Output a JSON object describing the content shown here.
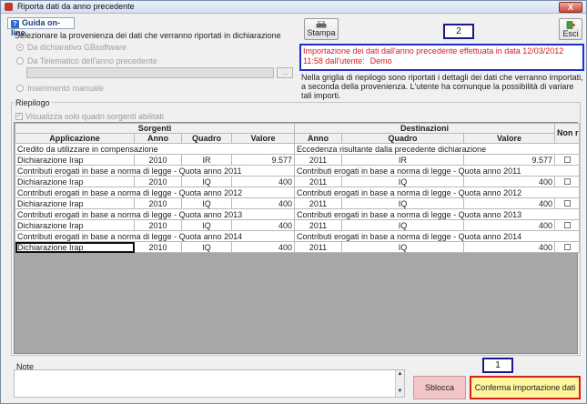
{
  "window": {
    "title": "Riporta dati da anno precedente",
    "close_label": "X"
  },
  "toolbar": {
    "help_label": "Guida on-line",
    "print_label": "Stampa",
    "exit_label": "Esci"
  },
  "provenance": {
    "title": "Selezionare la provenienza dei dati che verranno riportati in dichiarazione",
    "options": [
      "Da dichiarativo GBsoftware",
      "Da Telematico dell'anno precedente",
      "Inserimento manuale"
    ],
    "browse_label": "..."
  },
  "import_info": {
    "line1": "Importazione dei dati dall'anno precedente effettuata in data 12/03/2012",
    "line2": "11:58 dall'utente:",
    "user": "Demo",
    "description": "Nella griglia di riepilogo sono riportati i dettagli dei dati che verranno importati, a seconda della provenienza. L'utente ha comunque la possibilità di variare tali importi."
  },
  "badges": {
    "one": "1",
    "two": "2"
  },
  "summary": {
    "label": "Riepilogo",
    "filter_label": "Visualizza solo quadri sorgenti abilitati",
    "group_sources": "Sorgenti",
    "group_dest": "Destinazioni",
    "columns": {
      "app": "Applicazione",
      "year": "Anno",
      "quadro": "Quadro",
      "value": "Valore",
      "d_year": "Anno",
      "d_quadro": "Quadro",
      "d_value": "Valore",
      "non_rip": "Non rip"
    },
    "rows": [
      {
        "src_cat": "Credito da utilizzare in compensazione",
        "dst_cat": "Eccedenza risultante dalla precedente dichiarazione",
        "app": "Dichiarazione Irap",
        "year": "2010",
        "quadro": "IR",
        "value": "9.577",
        "d_year": "2011",
        "d_quadro": "IR",
        "d_value": "9.577"
      },
      {
        "src_cat": "Contributi erogati in base a norma di legge - Quota anno 2011",
        "dst_cat": "Contributi erogati in base a norma di legge - Quota anno 2011",
        "app": "Dichiarazione Irap",
        "year": "2010",
        "quadro": "IQ",
        "value": "400",
        "d_year": "2011",
        "d_quadro": "IQ",
        "d_value": "400"
      },
      {
        "src_cat": "Contributi erogati in base a norma di legge - Quota anno 2012",
        "dst_cat": "Contributi erogati in base a norma di legge - Quota anno 2012",
        "app": "Dichiarazione Irap",
        "year": "2010",
        "quadro": "IQ",
        "value": "400",
        "d_year": "2011",
        "d_quadro": "IQ",
        "d_value": "400"
      },
      {
        "src_cat": "Contributi erogati in base a norma di legge - Quota anno 2013",
        "dst_cat": "Contributi erogati in base a norma di legge - Quota anno 2013",
        "app": "Dichiarazione Irap",
        "year": "2010",
        "quadro": "IQ",
        "value": "400",
        "d_year": "2011",
        "d_quadro": "IQ",
        "d_value": "400"
      },
      {
        "src_cat": "Contributi erogati in base a norma di legge - Quota anno 2014",
        "dst_cat": "Contributi erogati in base a norma di legge - Quota anno 2014",
        "app": "Dichiarazione Irap",
        "year": "2010",
        "quadro": "IQ",
        "value": "400",
        "d_year": "2011",
        "d_quadro": "IQ",
        "d_value": "400"
      }
    ]
  },
  "notes": {
    "label": "Note"
  },
  "actions": {
    "unlock_label": "Sblocca",
    "confirm_label": "Conferma importazione dati"
  }
}
